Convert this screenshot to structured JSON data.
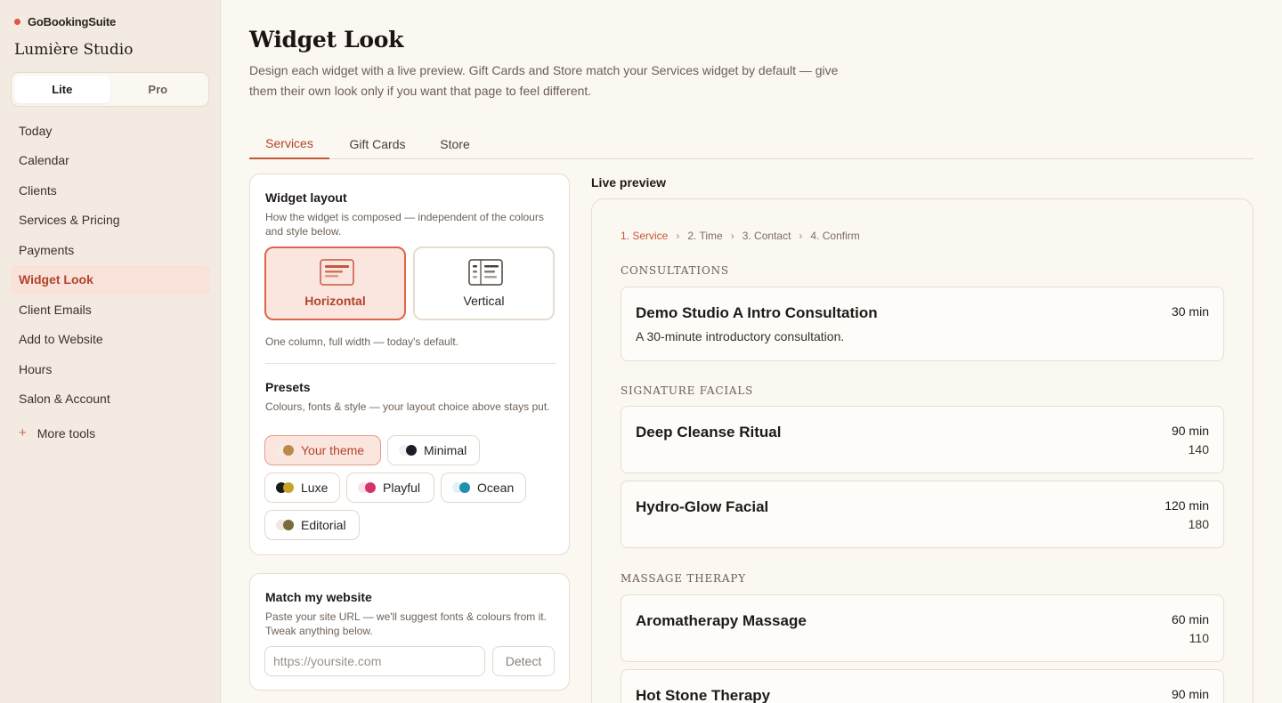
{
  "app": {
    "name": "GoBookingSuite",
    "studio": "Lumière Studio",
    "accent": "#c4573c"
  },
  "plan": {
    "options": [
      "Lite",
      "Pro"
    ],
    "selected": "Lite"
  },
  "sidebar": {
    "items": [
      {
        "label": "Today"
      },
      {
        "label": "Calendar"
      },
      {
        "label": "Clients"
      },
      {
        "label": "Services & Pricing"
      },
      {
        "label": "Payments"
      },
      {
        "label": "Widget Look",
        "active": true
      },
      {
        "label": "Client Emails"
      },
      {
        "label": "Add to Website"
      },
      {
        "label": "Hours"
      },
      {
        "label": "Salon & Account"
      }
    ],
    "more_tools": "More tools"
  },
  "page": {
    "title": "Widget Look",
    "subtitle": "Design each widget with a live preview. Gift Cards and Store match your Services widget by default — give them their own look only if you want that page to feel different."
  },
  "tabs": [
    {
      "label": "Services",
      "active": true
    },
    {
      "label": "Gift Cards"
    },
    {
      "label": "Store"
    }
  ],
  "layout_card": {
    "title": "Widget layout",
    "subtitle": "How the widget is composed — independent of the colours and style below.",
    "options": [
      {
        "label": "Horizontal",
        "icon": "horizontal-layout-icon",
        "selected": true
      },
      {
        "label": "Vertical",
        "icon": "vertical-layout-icon"
      }
    ],
    "hint": "One column, full width — today's default.",
    "presets_title": "Presets",
    "presets_subtitle": "Colours, fonts & style — your layout choice above stays put.",
    "presets": [
      {
        "label": "Your theme",
        "colors": [
          "#f4ede4",
          "#b98a4c"
        ],
        "selected": true
      },
      {
        "label": "Minimal",
        "colors": [
          "#f2f2f2",
          "#1c1c24"
        ]
      },
      {
        "label": "Luxe",
        "colors": [
          "#1a1a1a",
          "#c9a227"
        ]
      },
      {
        "label": "Playful",
        "colors": [
          "#fbe3ea",
          "#d6336c"
        ]
      },
      {
        "label": "Ocean",
        "colors": [
          "#e0f2f7",
          "#1f8fb0"
        ]
      },
      {
        "label": "Editorial",
        "colors": [
          "#efe9df",
          "#7a6a3c"
        ]
      }
    ]
  },
  "match_card": {
    "title": "Match my website",
    "subtitle": "Paste your site URL — we'll suggest fonts & colours from it. Tweak anything below.",
    "input_placeholder": "https://yoursite.com",
    "detect_label": "Detect"
  },
  "preview": {
    "label": "Live preview",
    "steps": [
      "1. Service",
      "2. Time",
      "3. Contact",
      "4. Confirm"
    ],
    "categories": [
      {
        "name": "Consultations",
        "services": [
          {
            "name": "Demo Studio A Intro Consultation",
            "description": "A 30-minute introductory consultation.",
            "duration": "30 min",
            "price": ""
          }
        ]
      },
      {
        "name": "Signature Facials",
        "services": [
          {
            "name": "Deep Cleanse Ritual",
            "description": "",
            "duration": "90 min",
            "price": "140"
          },
          {
            "name": "Hydro-Glow Facial",
            "description": "",
            "duration": "120 min",
            "price": "180"
          }
        ]
      },
      {
        "name": "Massage Therapy",
        "services": [
          {
            "name": "Aromatherapy Massage",
            "description": "",
            "duration": "60 min",
            "price": "110"
          },
          {
            "name": "Hot Stone Therapy",
            "description": "",
            "duration": "90 min",
            "price": ""
          }
        ]
      }
    ]
  }
}
